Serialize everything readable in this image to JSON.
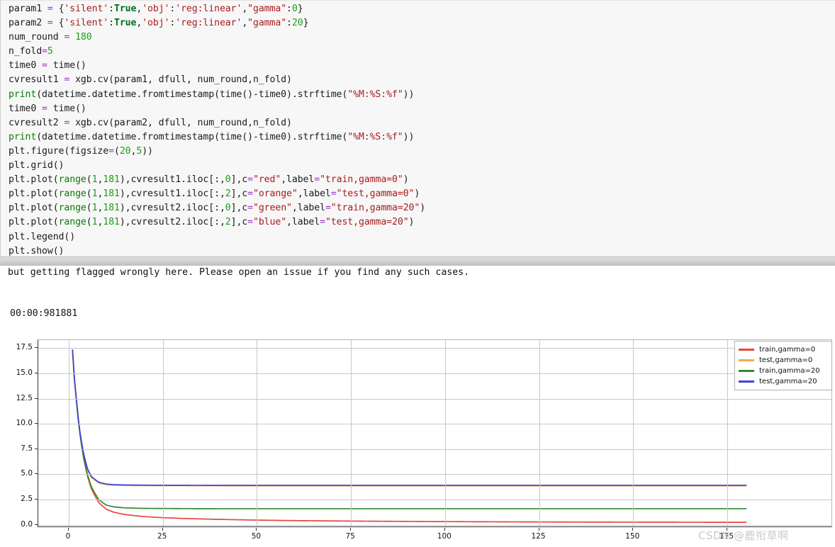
{
  "code": {
    "lines": [
      [
        {
          "t": "param1 ",
          "c": "pl"
        },
        {
          "t": "=",
          "c": "op"
        },
        {
          "t": " {",
          "c": "pl"
        },
        {
          "t": "'silent'",
          "c": "str"
        },
        {
          "t": ":",
          "c": "pl"
        },
        {
          "t": "True",
          "c": "kw"
        },
        {
          "t": ",",
          "c": "pl"
        },
        {
          "t": "'obj'",
          "c": "str"
        },
        {
          "t": ":",
          "c": "pl"
        },
        {
          "t": "'reg:linear'",
          "c": "str"
        },
        {
          "t": ",",
          "c": "pl"
        },
        {
          "t": "\"gamma\"",
          "c": "str"
        },
        {
          "t": ":",
          "c": "pl"
        },
        {
          "t": "0",
          "c": "num"
        },
        {
          "t": "}",
          "c": "pl"
        }
      ],
      [
        {
          "t": "param2 ",
          "c": "pl"
        },
        {
          "t": "=",
          "c": "op"
        },
        {
          "t": " {",
          "c": "pl"
        },
        {
          "t": "'silent'",
          "c": "str"
        },
        {
          "t": ":",
          "c": "pl"
        },
        {
          "t": "True",
          "c": "kw"
        },
        {
          "t": ",",
          "c": "pl"
        },
        {
          "t": "'obj'",
          "c": "str"
        },
        {
          "t": ":",
          "c": "pl"
        },
        {
          "t": "'reg:linear'",
          "c": "str"
        },
        {
          "t": ",",
          "c": "pl"
        },
        {
          "t": "\"gamma\"",
          "c": "str"
        },
        {
          "t": ":",
          "c": "pl"
        },
        {
          "t": "20",
          "c": "num"
        },
        {
          "t": "}",
          "c": "pl"
        }
      ],
      [
        {
          "t": "num_round ",
          "c": "pl"
        },
        {
          "t": "=",
          "c": "op"
        },
        {
          "t": " ",
          "c": "pl"
        },
        {
          "t": "180",
          "c": "num"
        }
      ],
      [
        {
          "t": "n_fold",
          "c": "pl"
        },
        {
          "t": "=",
          "c": "op"
        },
        {
          "t": "5",
          "c": "num"
        }
      ],
      [
        {
          "t": "time0 ",
          "c": "pl"
        },
        {
          "t": "=",
          "c": "op"
        },
        {
          "t": " time()",
          "c": "pl"
        }
      ],
      [
        {
          "t": "cvresult1 ",
          "c": "pl"
        },
        {
          "t": "=",
          "c": "op"
        },
        {
          "t": " xgb.cv(param1, dfull, num_round,n_fold)",
          "c": "pl"
        }
      ],
      [
        {
          "t": "print",
          "c": "fn"
        },
        {
          "t": "(datetime.datetime.fromtimestamp(time()-time0).strftime(",
          "c": "pl"
        },
        {
          "t": "\"%M:%S:%f\"",
          "c": "str"
        },
        {
          "t": "))",
          "c": "pl"
        }
      ],
      [
        {
          "t": "time0 ",
          "c": "pl"
        },
        {
          "t": "=",
          "c": "op"
        },
        {
          "t": " time()",
          "c": "pl"
        }
      ],
      [
        {
          "t": "cvresult2 ",
          "c": "pl"
        },
        {
          "t": "=",
          "c": "op"
        },
        {
          "t": " xgb.cv(param2, dfull, num_round,n_fold)",
          "c": "pl"
        }
      ],
      [
        {
          "t": "print",
          "c": "fn"
        },
        {
          "t": "(datetime.datetime.fromtimestamp(time()-time0).strftime(",
          "c": "pl"
        },
        {
          "t": "\"%M:%S:%f\"",
          "c": "str"
        },
        {
          "t": "))",
          "c": "pl"
        }
      ],
      [
        {
          "t": "plt.figure(figsize",
          "c": "pl"
        },
        {
          "t": "=",
          "c": "op"
        },
        {
          "t": "(",
          "c": "pl"
        },
        {
          "t": "20",
          "c": "num"
        },
        {
          "t": ",",
          "c": "pl"
        },
        {
          "t": "5",
          "c": "num"
        },
        {
          "t": "))",
          "c": "pl"
        }
      ],
      [
        {
          "t": "plt.grid()",
          "c": "pl"
        }
      ],
      [
        {
          "t": "plt.plot(",
          "c": "pl"
        },
        {
          "t": "range",
          "c": "fn"
        },
        {
          "t": "(",
          "c": "pl"
        },
        {
          "t": "1",
          "c": "num"
        },
        {
          "t": ",",
          "c": "pl"
        },
        {
          "t": "181",
          "c": "num"
        },
        {
          "t": "),cvresult1.iloc[:,",
          "c": "pl"
        },
        {
          "t": "0",
          "c": "num"
        },
        {
          "t": "],c",
          "c": "pl"
        },
        {
          "t": "=",
          "c": "op"
        },
        {
          "t": "\"red\"",
          "c": "str"
        },
        {
          "t": ",label",
          "c": "pl"
        },
        {
          "t": "=",
          "c": "op"
        },
        {
          "t": "\"train,gamma=0\"",
          "c": "str"
        },
        {
          "t": ")",
          "c": "pl"
        }
      ],
      [
        {
          "t": "plt.plot(",
          "c": "pl"
        },
        {
          "t": "range",
          "c": "fn"
        },
        {
          "t": "(",
          "c": "pl"
        },
        {
          "t": "1",
          "c": "num"
        },
        {
          "t": ",",
          "c": "pl"
        },
        {
          "t": "181",
          "c": "num"
        },
        {
          "t": "),cvresult1.iloc[:,",
          "c": "pl"
        },
        {
          "t": "2",
          "c": "num"
        },
        {
          "t": "],c",
          "c": "pl"
        },
        {
          "t": "=",
          "c": "op"
        },
        {
          "t": "\"orange\"",
          "c": "str"
        },
        {
          "t": ",label",
          "c": "pl"
        },
        {
          "t": "=",
          "c": "op"
        },
        {
          "t": "\"test,gamma=0\"",
          "c": "str"
        },
        {
          "t": ")",
          "c": "pl"
        }
      ],
      [
        {
          "t": "plt.plot(",
          "c": "pl"
        },
        {
          "t": "range",
          "c": "fn"
        },
        {
          "t": "(",
          "c": "pl"
        },
        {
          "t": "1",
          "c": "num"
        },
        {
          "t": ",",
          "c": "pl"
        },
        {
          "t": "181",
          "c": "num"
        },
        {
          "t": "),cvresult2.iloc[:,",
          "c": "pl"
        },
        {
          "t": "0",
          "c": "num"
        },
        {
          "t": "],c",
          "c": "pl"
        },
        {
          "t": "=",
          "c": "op"
        },
        {
          "t": "\"green\"",
          "c": "str"
        },
        {
          "t": ",label",
          "c": "pl"
        },
        {
          "t": "=",
          "c": "op"
        },
        {
          "t": "\"train,gamma=20\"",
          "c": "str"
        },
        {
          "t": ")",
          "c": "pl"
        }
      ],
      [
        {
          "t": "plt.plot(",
          "c": "pl"
        },
        {
          "t": "range",
          "c": "fn"
        },
        {
          "t": "(",
          "c": "pl"
        },
        {
          "t": "1",
          "c": "num"
        },
        {
          "t": ",",
          "c": "pl"
        },
        {
          "t": "181",
          "c": "num"
        },
        {
          "t": "),cvresult2.iloc[:,",
          "c": "pl"
        },
        {
          "t": "2",
          "c": "num"
        },
        {
          "t": "],c",
          "c": "pl"
        },
        {
          "t": "=",
          "c": "op"
        },
        {
          "t": "\"blue\"",
          "c": "str"
        },
        {
          "t": ",label",
          "c": "pl"
        },
        {
          "t": "=",
          "c": "op"
        },
        {
          "t": "\"test,gamma=20\"",
          "c": "str"
        },
        {
          "t": ")",
          "c": "pl"
        }
      ],
      [
        {
          "t": "plt.legend()",
          "c": "pl"
        }
      ],
      [
        {
          "t": "plt.show()",
          "c": "pl"
        }
      ]
    ]
  },
  "notice": {
    "text": "but getting flagged wrongly here. Please open an issue if you find any such cases."
  },
  "stdout": {
    "elapsed": "00:00:981881"
  },
  "watermark": {
    "text": "CSDN @鹿衔草啊"
  },
  "chart_data": {
    "type": "line",
    "title": "",
    "xlabel": "",
    "ylabel": "",
    "xlim": [
      1,
      180
    ],
    "ylim": [
      -0.3,
      18.3
    ],
    "grid": true,
    "legend_position": "upper right",
    "xticks": [
      0,
      25,
      50,
      75,
      100,
      125,
      150,
      175
    ],
    "yticks": [
      0.0,
      2.5,
      5.0,
      7.5,
      10.0,
      12.5,
      15.0,
      17.5
    ],
    "ytick_labels": [
      "0.0",
      "2.5",
      "5.0",
      "7.5",
      "10.0",
      "12.5",
      "15.0",
      "17.5"
    ],
    "xtick_labels": [
      "0",
      "25",
      "50",
      "75",
      "100",
      "125",
      "150",
      "175"
    ],
    "series": [
      {
        "name": "train,gamma=0",
        "color": "#e8453c",
        "x": [
          1,
          2,
          3,
          4,
          5,
          6,
          8,
          10,
          12,
          15,
          20,
          25,
          30,
          40,
          50,
          60,
          80,
          100,
          120,
          140,
          160,
          180
        ],
        "values": [
          17.3,
          12.4,
          8.9,
          6.5,
          4.8,
          3.6,
          2.2,
          1.55,
          1.25,
          1.02,
          0.82,
          0.71,
          0.64,
          0.54,
          0.47,
          0.42,
          0.36,
          0.32,
          0.29,
          0.27,
          0.26,
          0.25
        ]
      },
      {
        "name": "test,gamma=0",
        "color": "#f0ad4e",
        "x": [
          1,
          2,
          3,
          4,
          5,
          6,
          8,
          10,
          12,
          15,
          20,
          25,
          30,
          40,
          50,
          60,
          80,
          100,
          120,
          140,
          160,
          180
        ],
        "values": [
          17.32,
          12.5,
          9.1,
          6.9,
          5.45,
          4.7,
          4.15,
          3.98,
          3.93,
          3.9,
          3.89,
          3.88,
          3.88,
          3.87,
          3.87,
          3.87,
          3.87,
          3.87,
          3.87,
          3.87,
          3.87,
          3.87
        ]
      },
      {
        "name": "train,gamma=20",
        "color": "#2e8b2e",
        "x": [
          1,
          2,
          3,
          4,
          5,
          6,
          8,
          10,
          12,
          15,
          20,
          25,
          30,
          40,
          50,
          60,
          80,
          100,
          120,
          140,
          160,
          180
        ],
        "values": [
          17.3,
          12.4,
          8.95,
          6.6,
          4.95,
          3.8,
          2.5,
          1.95,
          1.78,
          1.68,
          1.63,
          1.62,
          1.61,
          1.6,
          1.6,
          1.6,
          1.6,
          1.6,
          1.6,
          1.6,
          1.6,
          1.6
        ]
      },
      {
        "name": "test,gamma=20",
        "color": "#4242d4",
        "x": [
          1,
          2,
          3,
          4,
          5,
          6,
          8,
          10,
          12,
          15,
          20,
          25,
          30,
          40,
          50,
          60,
          80,
          100,
          120,
          140,
          160,
          180
        ],
        "values": [
          17.33,
          12.55,
          9.15,
          6.98,
          5.55,
          4.8,
          4.22,
          4.04,
          3.98,
          3.95,
          3.93,
          3.92,
          3.92,
          3.91,
          3.91,
          3.91,
          3.91,
          3.91,
          3.91,
          3.91,
          3.91,
          3.91
        ]
      }
    ]
  }
}
